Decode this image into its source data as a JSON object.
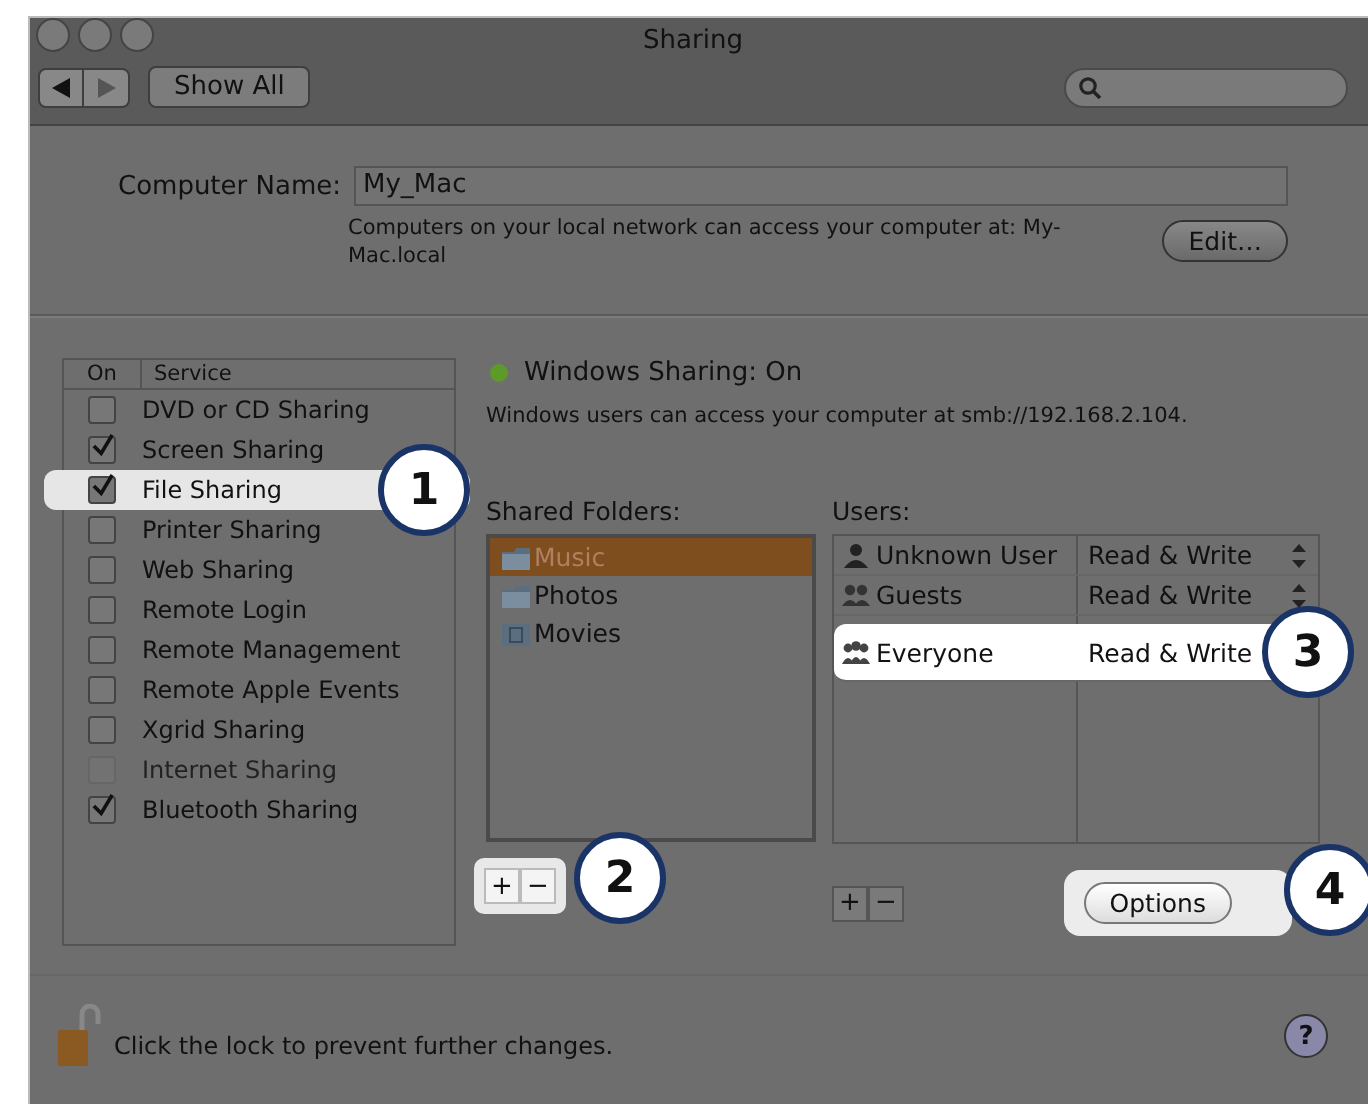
{
  "window": {
    "title": "Sharing"
  },
  "toolbar": {
    "show_all": "Show All"
  },
  "computer_name": {
    "label": "Computer Name:",
    "value": "My_Mac",
    "note": "Computers on your local network can access your computer at: My-Mac.local",
    "edit_button": "Edit…"
  },
  "services": {
    "columns": [
      "On",
      "Service"
    ],
    "items": [
      {
        "name": "DVD or CD Sharing",
        "checked": false,
        "disabled": false
      },
      {
        "name": "Screen Sharing",
        "checked": true,
        "disabled": false
      },
      {
        "name": "File Sharing",
        "checked": true,
        "disabled": false,
        "callout": "1"
      },
      {
        "name": "Printer Sharing",
        "checked": false,
        "disabled": false
      },
      {
        "name": "Web Sharing",
        "checked": false,
        "disabled": false
      },
      {
        "name": "Remote Login",
        "checked": false,
        "disabled": false
      },
      {
        "name": "Remote Management",
        "checked": false,
        "disabled": false
      },
      {
        "name": "Remote Apple Events",
        "checked": false,
        "disabled": false
      },
      {
        "name": "Xgrid Sharing",
        "checked": false,
        "disabled": false
      },
      {
        "name": "Internet Sharing",
        "checked": false,
        "disabled": true
      },
      {
        "name": "Bluetooth Sharing",
        "checked": true,
        "disabled": false
      }
    ]
  },
  "status": {
    "label": "Windows Sharing: On",
    "on": true,
    "note": "Windows users can access your computer at smb://192.168.2.104."
  },
  "shared_folders": {
    "label": "Shared Folders:",
    "items": [
      {
        "name": "Music",
        "kind": "folder",
        "selected": true
      },
      {
        "name": "Photos",
        "kind": "folder",
        "selected": false
      },
      {
        "name": "Movies",
        "kind": "movies",
        "selected": false
      }
    ],
    "buttons": [
      "+",
      "−"
    ],
    "callout": "2"
  },
  "users": {
    "label": "Users:",
    "rows": [
      {
        "name": "Unknown User",
        "kind": "user",
        "permission": "Read & Write"
      },
      {
        "name": "Guests",
        "kind": "group",
        "permission": "Read & Write"
      },
      {
        "name": "Everyone",
        "kind": "everyone",
        "permission": "Read & Write",
        "callout": "3"
      }
    ],
    "buttons": [
      "+",
      "−"
    ]
  },
  "options_button": {
    "label": "Options",
    "callout": "4"
  },
  "footer": {
    "lock_note": "Click the lock to prevent further changes.",
    "help": "?"
  }
}
